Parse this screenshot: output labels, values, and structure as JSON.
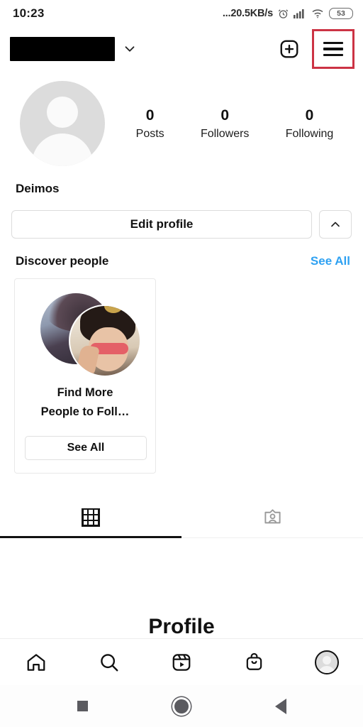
{
  "status_bar": {
    "time": "10:23",
    "network_speed": "...20.5KB/s",
    "alarm_icon": "alarm-clock-icon",
    "signal_icon": "cellular-signal-icon",
    "wifi_icon": "wifi-icon",
    "battery_level": "53"
  },
  "header": {
    "username_redacted": "",
    "chevron_icon": "chevron-down-icon",
    "add_icon": "plus-square-icon",
    "menu_icon": "hamburger-menu-icon",
    "highlight_color": "#cc3344"
  },
  "profile": {
    "avatar": "default-avatar-placeholder",
    "display_name": "Deimos",
    "stats": [
      {
        "value": "0",
        "label": "Posts"
      },
      {
        "value": "0",
        "label": "Followers"
      },
      {
        "value": "0",
        "label": "Following"
      }
    ],
    "edit_profile_label": "Edit profile",
    "collapse_icon": "chevron-up-icon"
  },
  "discover": {
    "title": "Discover people",
    "see_all_link": "See All",
    "link_color": "#2ea1f2",
    "card": {
      "photos": [
        "suggested-user-photo-back",
        "suggested-user-photo-front"
      ],
      "text_line1": "Find More",
      "text_line2": "People to Foll…",
      "button_label": "See All"
    }
  },
  "tabs": [
    {
      "name": "grid-tab",
      "icon": "grid-icon",
      "active": true
    },
    {
      "name": "tagged-tab",
      "icon": "tagged-photos-icon",
      "active": false
    }
  ],
  "overlay": {
    "title": "Profile"
  },
  "bottom_nav": [
    {
      "name": "home",
      "icon": "home-icon"
    },
    {
      "name": "search",
      "icon": "search-icon"
    },
    {
      "name": "reels",
      "icon": "reels-icon"
    },
    {
      "name": "shop",
      "icon": "shop-bag-icon"
    },
    {
      "name": "profile",
      "icon": "profile-avatar-icon"
    }
  ],
  "system_nav": [
    {
      "name": "recents",
      "icon": "square-icon"
    },
    {
      "name": "home",
      "icon": "circle-icon"
    },
    {
      "name": "back",
      "icon": "triangle-back-icon"
    }
  ]
}
